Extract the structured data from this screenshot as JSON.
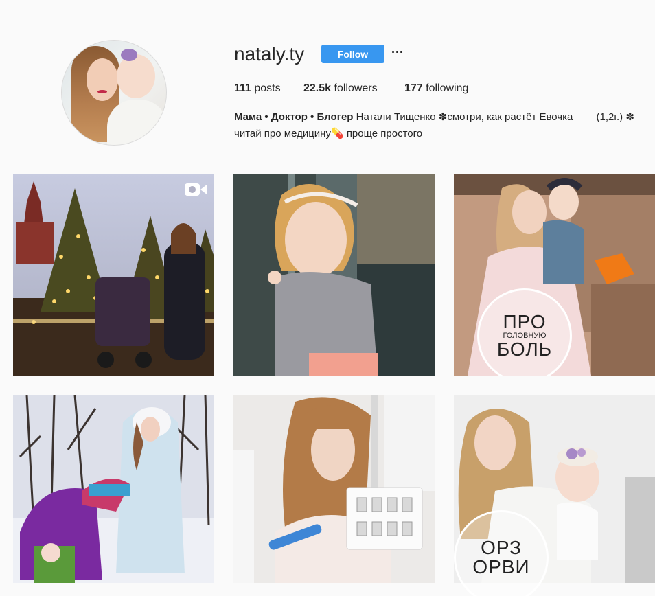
{
  "profile": {
    "username": "nataly.ty",
    "follow_label": "Follow",
    "more_label": "···",
    "stats": {
      "posts_count": "111",
      "posts_label": " posts",
      "followers_count": "22.5k",
      "followers_label": " followers",
      "following_count": "177",
      "following_label": " following"
    },
    "bio": {
      "full_name": "Мама • Доктор • Блогер",
      "line1": " Натали Тищенко ✽смотри, как растёт Евочка　　 (1,2г.) ✽",
      "line2": "читай про медицину💊 проще простого"
    },
    "accent_color": "#3897f0"
  },
  "posts": [
    {
      "name": "post-christmas-trees",
      "icon": "video-camera-icon"
    },
    {
      "name": "post-toddler-aquarium"
    },
    {
      "name": "post-pro-golovnuyu-bol",
      "stamp_big_1": "ПРО",
      "stamp_small": "ГОЛОВНУЮ",
      "stamp_big_2": "БОЛЬ"
    },
    {
      "name": "post-winter-stroller"
    },
    {
      "name": "post-comb-and-vials"
    },
    {
      "name": "post-orz-orvi",
      "stamp_big_1": "ОРЗ",
      "stamp_big_2": "ОРВИ"
    }
  ]
}
